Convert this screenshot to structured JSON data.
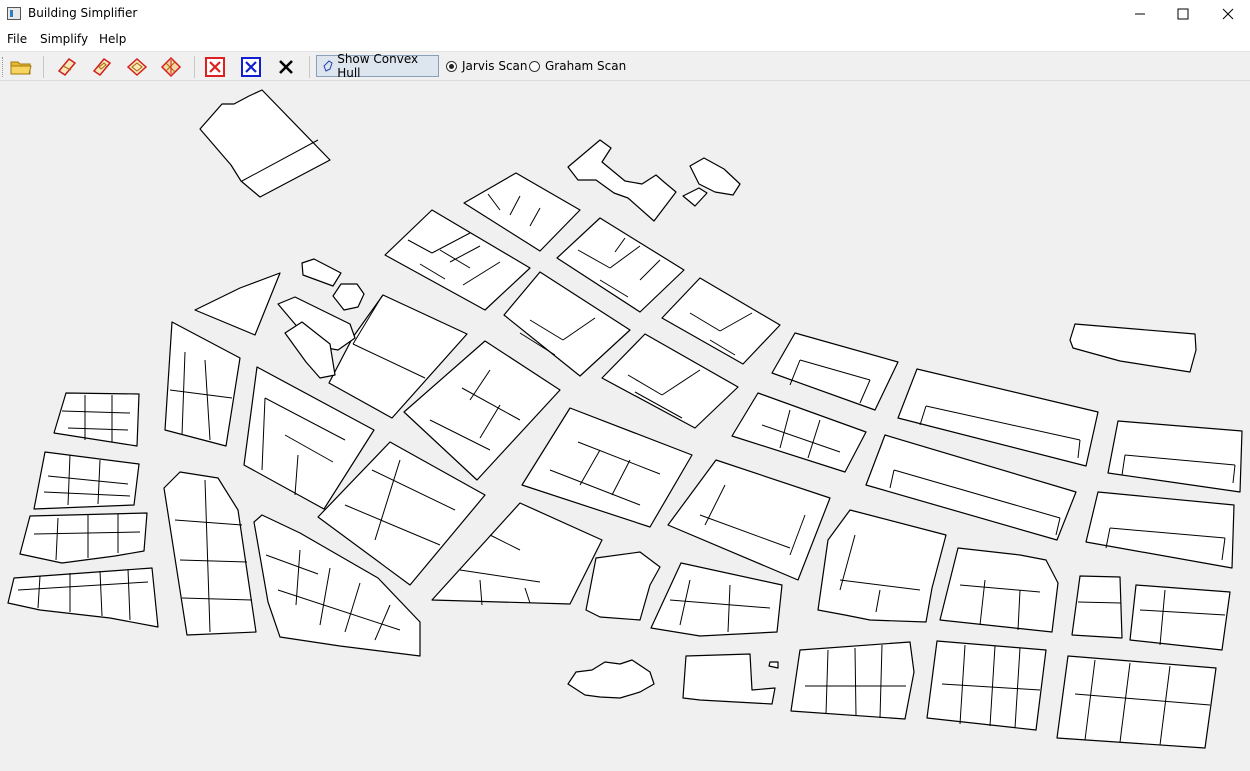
{
  "window": {
    "title": "Building Simplifier"
  },
  "menu": [
    "File",
    "Simplify",
    "Help"
  ],
  "toolbar": {
    "icons": [
      "open-folder-icon",
      "simplify-1-icon",
      "simplify-2-icon",
      "simplify-3-icon",
      "simplify-4-icon",
      "clear-red-icon",
      "clear-blue-icon",
      "clear-black-icon"
    ],
    "show_hull_label": "Show Convex Hull",
    "algorithms": [
      {
        "label": "Jarvis Scan",
        "selected": true
      },
      {
        "label": "Graham Scan",
        "selected": false
      }
    ]
  },
  "colors": {
    "canvas_bg": "#f0f0f0",
    "building_fill": "#ffffff",
    "building_stroke": "#000000",
    "clear_red": "#e02020",
    "clear_blue": "#1020d0"
  }
}
